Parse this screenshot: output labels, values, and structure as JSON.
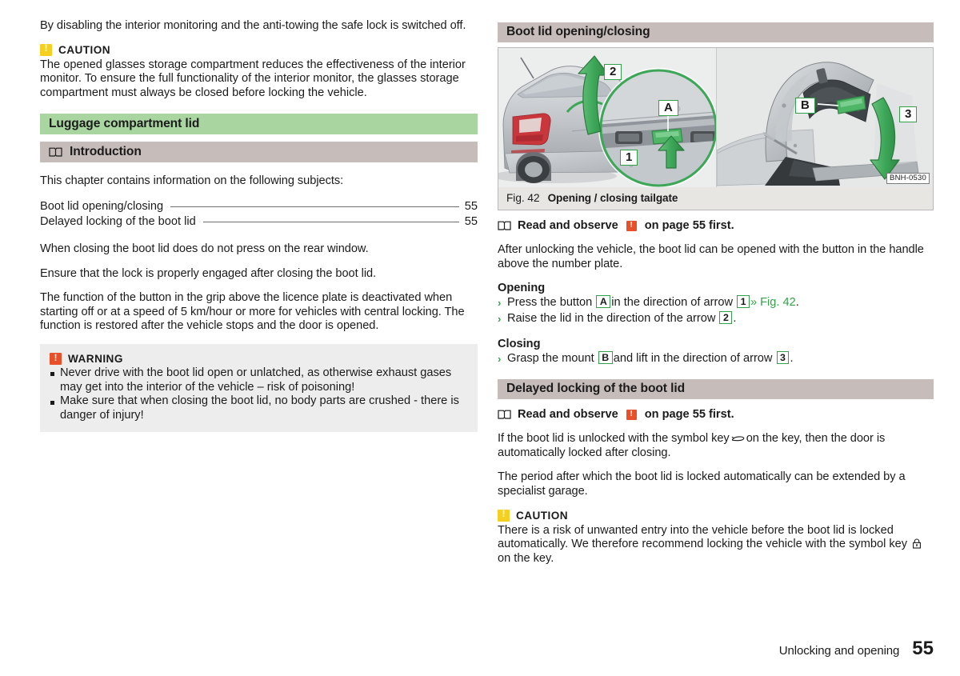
{
  "left_column": {
    "intro_paragraph": "By disabling the interior monitoring and the anti-towing the safe lock is switched off.",
    "caution": {
      "badge": "!",
      "title": "CAUTION",
      "text": "The opened glasses storage compartment reduces the effectiveness of the interior monitor. To ensure the full functionality of the interior monitor, the glasses storage compartment must always be closed before locking the vehicle."
    },
    "chapter_heading": "Luggage compartment lid",
    "introduction_heading": "Introduction",
    "introduction_icon": "book-icon",
    "intro_lead": "This chapter contains information on the following subjects:",
    "toc": [
      {
        "label": "Boot lid opening/closing",
        "page": "55"
      },
      {
        "label": "Delayed locking of the boot lid",
        "page": "55"
      }
    ],
    "paragraphs": [
      "When closing the boot lid does do not press on the rear window.",
      "Ensure that the lock is properly engaged after closing the boot lid.",
      "The function of the button in the grip above the licence plate is deactivated when starting off or at a speed of 5 km/hour or more for vehicles with central locking. The function is restored after the vehicle stops and the door is opened."
    ],
    "warning": {
      "badge": "!",
      "title": "WARNING",
      "bullets": [
        "Never drive with the boot lid open or unlatched, as otherwise exhaust gases may get into the interior of the vehicle – risk of poisoning!",
        "Make sure that when closing the boot lid, no body parts are crushed - there is danger of injury!"
      ]
    }
  },
  "right_column": {
    "section_heading": "Boot lid opening/closing",
    "figure": {
      "image_code": "BNH-0530",
      "caption_number": "Fig. 42",
      "caption_title": "Opening / closing tailgate",
      "callouts": [
        "2",
        "A",
        "1",
        "B",
        "3"
      ]
    },
    "observe_1": {
      "icon": "book-icon",
      "prefix": "Read and observe",
      "badge": "!",
      "suffix": "on page 55 first."
    },
    "intro_text": "After unlocking the vehicle, the boot lid can be opened with the button in the handle above the number plate.",
    "opening": {
      "heading": "Opening",
      "steps": [
        {
          "arrow": "›",
          "part1": "Press the button",
          "key1": "A",
          "part2": "in the direction of arrow",
          "key2": "1",
          "xref": "» Fig. 42",
          "tail": "."
        },
        {
          "arrow": "›",
          "part1": "Raise the lid in the direction of the arrow",
          "key1": "2",
          "tail": "."
        }
      ]
    },
    "closing": {
      "heading": "Closing",
      "steps": [
        {
          "arrow": "›",
          "part1": "Grasp the mount",
          "key1": "B",
          "part2": "and lift in the direction of arrow",
          "key2": "3",
          "tail": "."
        }
      ]
    },
    "delayed_heading": "Delayed locking of the boot lid",
    "observe_2": {
      "icon": "book-icon",
      "prefix": "Read and observe",
      "badge": "!",
      "suffix": "on page 55 first."
    },
    "delayed_paragraph_1a": "If the boot lid is unlocked with the symbol key",
    "delayed_paragraph_1_glyph": "unlock-car-icon",
    "delayed_paragraph_1b": "on the key, then the door is automatically locked after closing.",
    "delayed_paragraph_2": "The period after which the boot lid is locked automatically can be extended by a specialist garage.",
    "caution": {
      "badge": "!",
      "title": "CAUTION",
      "text_a": "There is a risk of unwanted entry into the vehicle before the boot lid is locked automatically. We therefore recommend locking the vehicle with the symbol key",
      "glyph": "padlock-closed-icon",
      "text_b": "on the key."
    }
  },
  "footer": {
    "title": "Unlocking and opening",
    "page_number": "55"
  },
  "colors": {
    "chapter_bar": "#a9d6a0",
    "section_bar": "#c6bcba",
    "caution_badge": "#f5d020",
    "warning_badge": "#e8502a",
    "accent_green": "#35a04a",
    "box_background": "#ededed",
    "figure_caption_background": "#e8e6e2"
  }
}
